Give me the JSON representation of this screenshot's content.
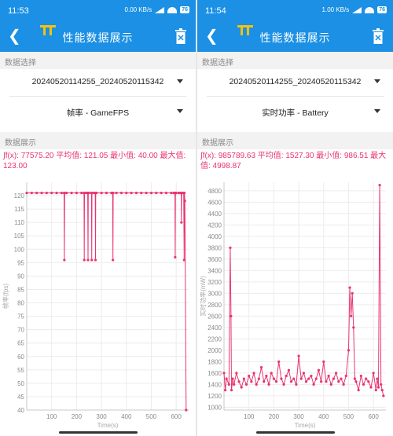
{
  "screens": [
    {
      "status_time": "11:53",
      "status_speed": "0.00 KB/s",
      "battery": "76",
      "app_title": "性能数据展示",
      "section_select_label": "数据选择",
      "file_selected": "20240520114255_20240520115342",
      "metric_selected": "帧率 - GameFPS",
      "section_display_label": "数据展示",
      "formula_text": "∫f(x): 77575.20 平均值: 121.05 最小值: 40.00 最大值: 123.00",
      "icons": {
        "back": "back-arrow-icon",
        "logo": "perfdog-logo-icon",
        "delete": "trash-icon"
      },
      "chart_data": {
        "type": "line",
        "xlabel": "Time(s)",
        "ylabel": "帧率(fps)",
        "xticks": [
          100,
          200,
          300,
          400,
          500,
          600
        ],
        "yticks": [
          40,
          45,
          50,
          55,
          60,
          65,
          70,
          75,
          80,
          85,
          90,
          95,
          100,
          105,
          110,
          115,
          120
        ],
        "xlim": [
          0,
          650
        ],
        "ylim": [
          40,
          125
        ],
        "grid": true,
        "color": "#e8356f",
        "x": [
          0,
          20,
          40,
          60,
          80,
          100,
          120,
          140,
          150,
          151,
          152,
          160,
          180,
          200,
          220,
          230,
          231,
          232,
          240,
          245,
          246,
          247,
          250,
          260,
          261,
          262,
          270,
          275,
          276,
          277,
          280,
          300,
          320,
          340,
          345,
          346,
          347,
          360,
          380,
          400,
          420,
          440,
          460,
          480,
          500,
          520,
          540,
          560,
          580,
          590,
          595,
          596,
          597,
          600,
          610,
          615,
          620,
          621,
          622,
          625,
          630,
          632,
          633,
          635,
          640
        ],
        "y": [
          121,
          121,
          121,
          121,
          121,
          121,
          121,
          121,
          121,
          96,
          121,
          121,
          121,
          121,
          121,
          121,
          96,
          121,
          121,
          121,
          96,
          121,
          121,
          121,
          96,
          121,
          121,
          121,
          96,
          121,
          121,
          121,
          121,
          121,
          121,
          96,
          121,
          121,
          121,
          121,
          121,
          121,
          121,
          121,
          121,
          121,
          121,
          121,
          121,
          121,
          121,
          97,
          121,
          121,
          121,
          121,
          121,
          110,
          121,
          121,
          121,
          96,
          121,
          118,
          40
        ]
      }
    },
    {
      "status_time": "11:54",
      "status_speed": "1.00 KB/s",
      "battery": "76",
      "app_title": "性能数据展示",
      "section_select_label": "数据选择",
      "file_selected": "20240520114255_20240520115342",
      "metric_selected": "实时功率 - Battery",
      "section_display_label": "数据展示",
      "formula_text": "∫f(x): 985789.63 平均值: 1527.30 最小值: 986.51 最大值: 4998.87",
      "icons": {
        "back": "back-arrow-icon",
        "logo": "perfdog-logo-icon",
        "delete": "trash-icon"
      },
      "chart_data": {
        "type": "line",
        "xlabel": "Time(s)",
        "ylabel": "实时功率(mW)",
        "xticks": [
          100,
          200,
          300,
          400,
          500,
          600
        ],
        "yticks": [
          1000,
          1200,
          1400,
          1600,
          1800,
          2000,
          2200,
          2400,
          2600,
          2800,
          3000,
          3200,
          3400,
          3600,
          3800,
          4000,
          4200,
          4400,
          4600,
          4800
        ],
        "xlim": [
          0,
          650
        ],
        "ylim": [
          950,
          4950
        ],
        "grid": true,
        "color": "#e8356f",
        "x": [
          0,
          5,
          10,
          20,
          25,
          28,
          30,
          35,
          40,
          50,
          60,
          70,
          80,
          90,
          100,
          110,
          120,
          130,
          140,
          150,
          160,
          170,
          180,
          190,
          200,
          210,
          220,
          230,
          240,
          250,
          260,
          270,
          280,
          290,
          300,
          310,
          320,
          330,
          340,
          350,
          360,
          370,
          380,
          390,
          400,
          410,
          420,
          430,
          440,
          450,
          460,
          470,
          480,
          490,
          500,
          505,
          510,
          515,
          520,
          525,
          530,
          540,
          550,
          560,
          570,
          580,
          590,
          600,
          610,
          615,
          620,
          625,
          630,
          635,
          640
        ],
        "y": [
          1600,
          1300,
          1500,
          1400,
          3800,
          2600,
          1300,
          1500,
          1400,
          1600,
          1450,
          1350,
          1500,
          1400,
          1550,
          1450,
          1600,
          1400,
          1500,
          1700,
          1450,
          1550,
          1400,
          1600,
          1500,
          1450,
          1800,
          1500,
          1400,
          1550,
          1650,
          1450,
          1500,
          1400,
          1900,
          1500,
          1600,
          1450,
          1500,
          1550,
          1400,
          1500,
          1650,
          1450,
          1800,
          1450,
          1550,
          1400,
          1500,
          1600,
          1450,
          1500,
          1400,
          1550,
          2000,
          3100,
          2600,
          3000,
          2400,
          1500,
          1450,
          1300,
          1550,
          1400,
          1500,
          1450,
          1350,
          1600,
          1300,
          1500,
          1350,
          4900,
          1400,
          1300,
          1200
        ]
      }
    }
  ]
}
